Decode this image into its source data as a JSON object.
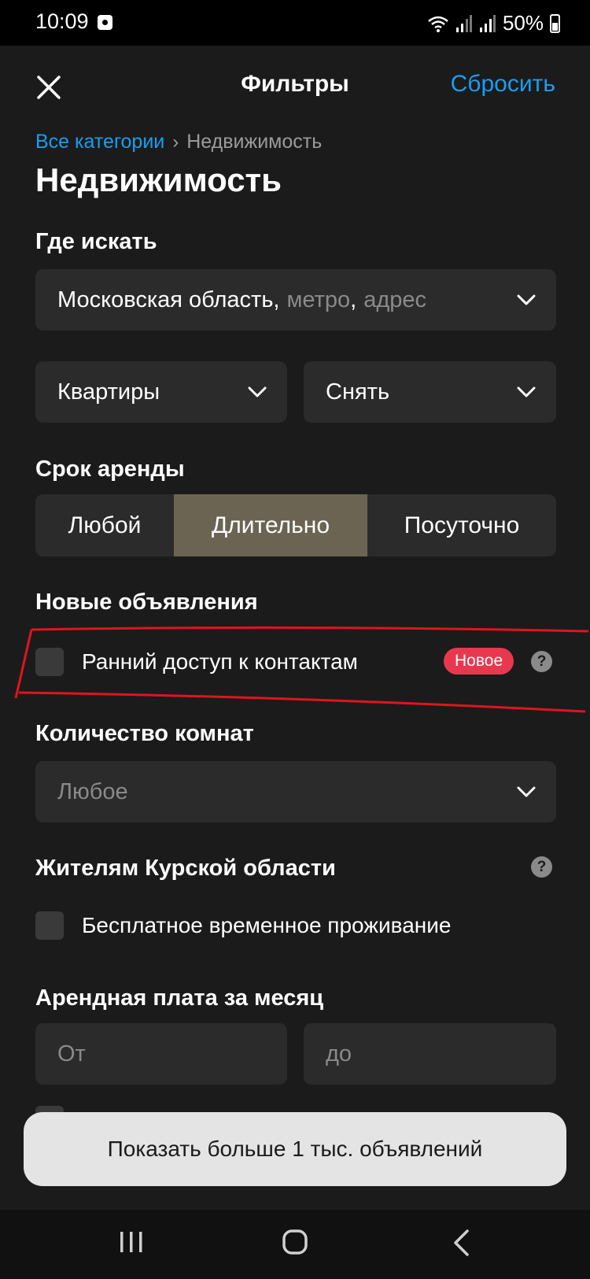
{
  "status_bar": {
    "time": "10:09",
    "battery": "50%"
  },
  "header": {
    "title": "Фильтры",
    "reset_label": "Сбросить"
  },
  "breadcrumb": {
    "parent": "Все категории",
    "separator": "›",
    "current": "Недвижимость"
  },
  "page_title": "Недвижимость",
  "where": {
    "label": "Где искать",
    "region": "Московская область,",
    "placeholder_metro": "метро",
    "comma": ",",
    "placeholder_address": "адрес"
  },
  "type_select": {
    "value": "Квартиры"
  },
  "deal_select": {
    "value": "Снять"
  },
  "rent_term": {
    "label": "Срок аренды",
    "options": [
      "Любой",
      "Длительно",
      "Посуточно"
    ],
    "selected": "Длительно"
  },
  "new_listings": {
    "label": "Новые объявления",
    "checkbox_label": "Ранний доступ к контактам",
    "badge": "Новое",
    "help": "?"
  },
  "rooms": {
    "label": "Количество комнат",
    "value": "Любое"
  },
  "kursk": {
    "label": "Жителям Курской области",
    "help": "?",
    "checkbox_label": "Бесплатное временное проживание"
  },
  "price": {
    "label": "Арендная плата за месяц",
    "from_placeholder": "От",
    "to_placeholder": "до"
  },
  "cta": {
    "label": "Показать больше 1 тыс. объявлений"
  },
  "colors": {
    "accent": "#1a9df0",
    "badge": "#e8384f",
    "annotation": "#e0141e",
    "segment_active": "#6c6452"
  },
  "icons": [
    "close-icon",
    "chevron-down-icon",
    "help-icon",
    "wifi-icon",
    "signal-icon",
    "battery-icon"
  ]
}
